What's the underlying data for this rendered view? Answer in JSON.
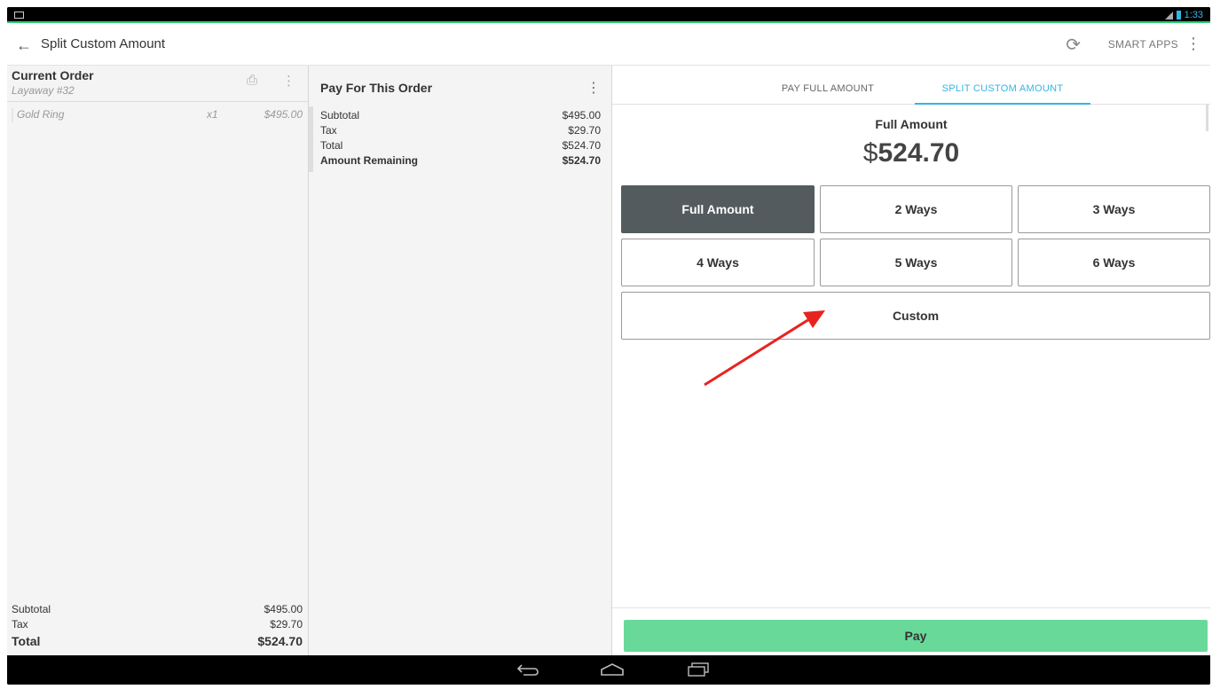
{
  "status_bar": {
    "time": "1:33"
  },
  "app_bar": {
    "title": "Split Custom Amount",
    "smart_apps_label": "SMART APPS"
  },
  "current_order": {
    "title": "Current Order",
    "subtitle": "Layaway #32",
    "items": [
      {
        "name": "Gold Ring",
        "qty": "x1",
        "price": "$495.00"
      }
    ],
    "subtotal_label": "Subtotal",
    "subtotal": "$495.00",
    "tax_label": "Tax",
    "tax": "$29.70",
    "total_label": "Total",
    "total": "$524.70"
  },
  "pay_for_order": {
    "title": "Pay For This Order",
    "subtotal_label": "Subtotal",
    "subtotal": "$495.00",
    "tax_label": "Tax",
    "tax": "$29.70",
    "total_label": "Total",
    "total": "$524.70",
    "remaining_label": "Amount Remaining",
    "remaining": "$524.70"
  },
  "payment": {
    "tabs": [
      {
        "label": "PAY FULL AMOUNT",
        "active": false
      },
      {
        "label": "SPLIT CUSTOM AMOUNT",
        "active": true
      }
    ],
    "full_amount_label": "Full Amount",
    "currency_symbol": "$",
    "full_amount_value": "524.70",
    "split_options": [
      "Full Amount",
      "2 Ways",
      "3 Ways",
      "4 Ways",
      "5 Ways",
      "6 Ways",
      "Custom"
    ],
    "selected_option": "Full Amount",
    "pay_label": "Pay"
  },
  "colors": {
    "accent": "#33b5e5",
    "selected_button": "#545b5f",
    "pay_button": "#69d99a",
    "annotation_arrow": "#e8231e"
  },
  "icons": {
    "back": "arrow-left-icon",
    "refresh": "refresh-icon",
    "overflow": "more-vert-icon",
    "print": "printer-icon",
    "nav_back": "nav-back-icon",
    "nav_home": "nav-home-icon",
    "nav_recent": "nav-recent-icon"
  }
}
